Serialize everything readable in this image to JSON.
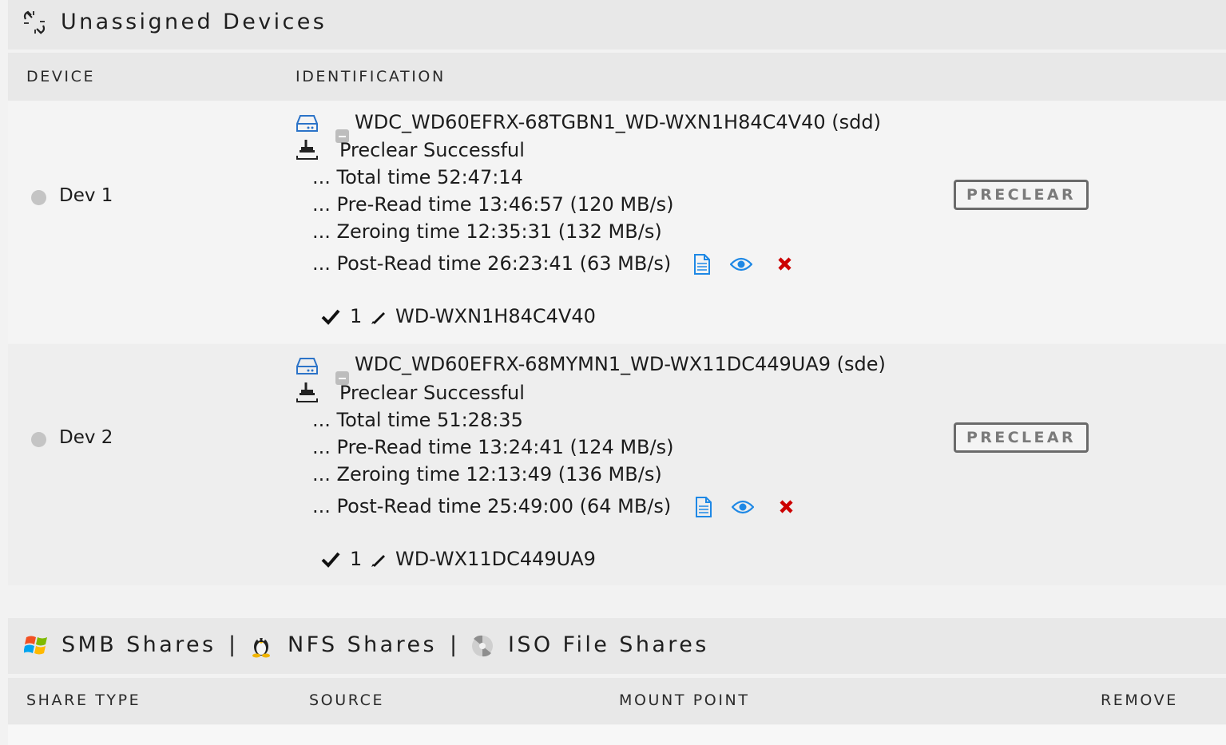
{
  "unassigned": {
    "title": "Unassigned Devices",
    "title_icon": "broken-link-icon",
    "columns": {
      "device": "DEVICE",
      "identification": "IDENTIFICATION"
    },
    "devices": [
      {
        "name": "Dev 1",
        "identification": "WDC_WD60EFRX-68TGBN1_WD-WXN1H84C4V40 (sdd)",
        "status": "Preclear Successful",
        "total": "... Total time 52:47:14",
        "preread": "... Pre-Read time 13:46:57 (120 MB/s)",
        "zeroing": "... Zeroing time 12:35:31 (132 MB/s)",
        "postread": "... Post-Read time 26:23:41 (63 MB/s)",
        "partition_num": "1",
        "partition_label": "WD-WXN1H84C4V40",
        "button": "PRECLEAR"
      },
      {
        "name": "Dev 2",
        "identification": "WDC_WD60EFRX-68MYMN1_WD-WX11DC449UA9 (sde)",
        "status": "Preclear Successful",
        "total": "... Total time 51:28:35",
        "preread": "... Pre-Read time 13:24:41 (124 MB/s)",
        "zeroing": "... Zeroing time 12:13:49 (136 MB/s)",
        "postread": "... Post-Read time 25:49:00 (64 MB/s)",
        "partition_num": "1",
        "partition_label": "WD-WX11DC449UA9",
        "button": "PRECLEAR"
      }
    ]
  },
  "shares": {
    "tabs": [
      {
        "label": "SMB Shares",
        "icon": "windows-icon"
      },
      {
        "label": "NFS Shares",
        "icon": "linux-penguin-icon"
      },
      {
        "label": "ISO File Shares",
        "icon": "disc-icon"
      }
    ],
    "separator": "|",
    "columns": {
      "type": "SHARE TYPE",
      "source": "SOURCE",
      "mount": "MOUNT POINT",
      "remove": "REMOVE"
    }
  },
  "colors": {
    "icon_blue": "#1e88e5",
    "delete_red": "#cc0000",
    "status_dot": "#c4c4c4"
  }
}
